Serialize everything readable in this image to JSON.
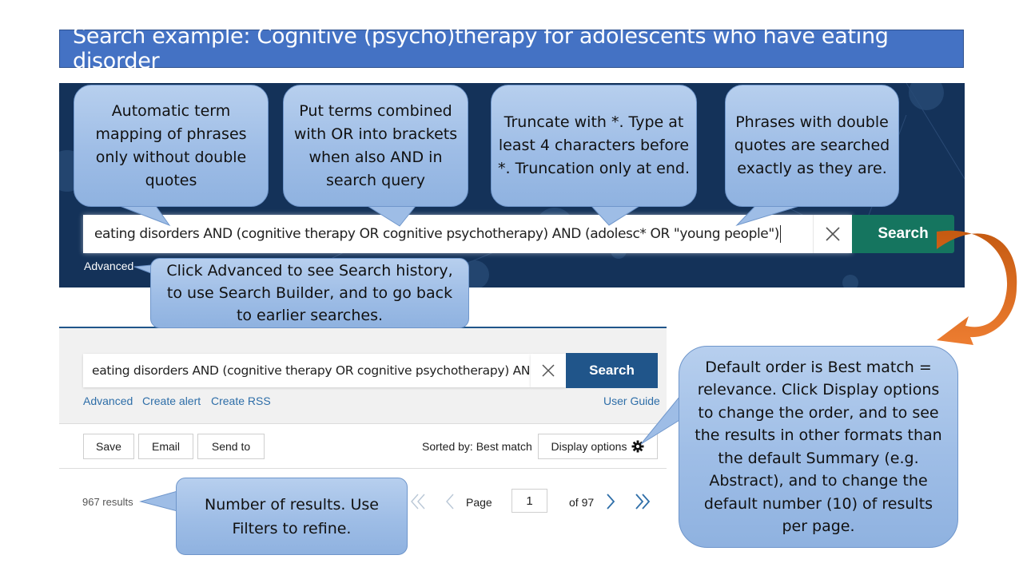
{
  "title": "Search example: Cognitive (psycho)therapy for adolescents who have eating disorder",
  "hero": {
    "query": "eating disorders AND (cognitive therapy OR cognitive psychotherapy) AND (adolesc* OR \"young people\")",
    "search_label": "Search",
    "advanced_label": "Advanced",
    "clear_icon": "close-icon"
  },
  "callouts": {
    "term_mapping": "Automatic term mapping of phrases only without double quotes",
    "brackets": "Put terms combined with OR into brackets when also AND in search query",
    "truncation": "Truncate with *. Type at least 4 characters before *. Truncation only at end.",
    "phrases": "Phrases with double quotes are searched exactly as they are.",
    "advanced": "Click Advanced to see Search history, to use Search Builder, and to go back to earlier searches.",
    "display": "Default order is Best match = relevance. Click Display options to change the order, and to see the results in other formats than the default Summary (e.g. Abstract), and to change the default number (10) of results per page.",
    "results": "Number of results. Use Filters to refine."
  },
  "results_page": {
    "query": "eating disorders AND (cognitive therapy OR cognitive psychotherapy) AND (",
    "search_label": "Search",
    "links": [
      "Advanced",
      "Create alert",
      "Create RSS"
    ],
    "user_guide": "User Guide",
    "actions": [
      "Save",
      "Email",
      "Send to"
    ],
    "sorted_by": "Sorted by: Best match",
    "display_options": "Display options",
    "results_count": "967 results",
    "page_label": "Page",
    "page_current": "1",
    "page_total": "of 97"
  },
  "colors": {
    "banner": "#4472c4",
    "hero_bg": "#143259",
    "hero_search": "#15755f",
    "results_search": "#20558a",
    "arrow": "#ed7d31"
  }
}
